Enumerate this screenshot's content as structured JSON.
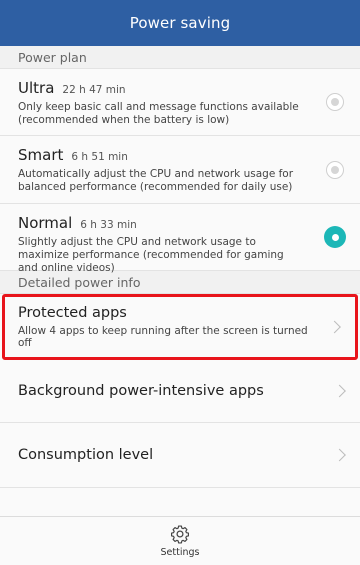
{
  "header": {
    "title": "Power saving"
  },
  "power_plan": {
    "section_label": "Power plan",
    "plans": [
      {
        "name": "Ultra",
        "time": "22 h 47 min",
        "description": "Only keep basic call and message functions available (recommended when the battery is low)",
        "selected": false
      },
      {
        "name": "Smart",
        "time": "6 h 51 min",
        "description": "Automatically adjust the CPU and network usage for balanced performance (recommended for daily use)",
        "selected": false
      },
      {
        "name": "Normal",
        "time": "6 h 33 min",
        "description": "Slightly adjust the CPU and network usage to maximize performance (recommended for gaming and online videos)",
        "selected": true
      }
    ]
  },
  "detail": {
    "section_label": "Detailed power info",
    "protected_apps": {
      "title": "Protected apps",
      "subtitle": "Allow 4 apps to keep running after the screen is turned off"
    },
    "background_apps": {
      "title": "Background power-intensive apps"
    },
    "consumption": {
      "title": "Consumption level"
    }
  },
  "bottom": {
    "settings_label": "Settings",
    "settings_icon": "gear-icon"
  },
  "colors": {
    "header_bg": "#2e5fa3",
    "accent": "#1cb7b7",
    "highlight_border": "#e8141b"
  }
}
